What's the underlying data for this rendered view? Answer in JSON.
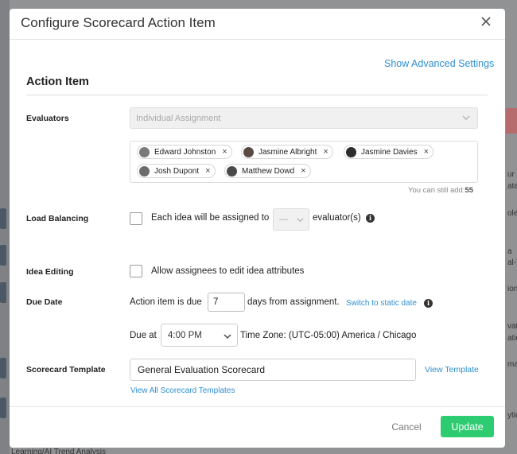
{
  "background": {
    "right_fragments": [
      "ur s",
      "ate",
      "ole",
      "a",
      "al-T",
      "ion",
      "vat",
      "atio",
      "ma",
      "ytic"
    ],
    "bottom_fragment": "Learning/AI Trend Analysis"
  },
  "modal": {
    "title": "Configure Scorecard Action Item",
    "close_icon": "close-icon",
    "advanced_link": "Show Advanced Settings",
    "section_title": "Action Item",
    "evaluators": {
      "label": "Evaluators",
      "assignment_type": "Individual Assignment",
      "chips": [
        {
          "name": "Edward Johnston",
          "avatar_color": "#7a7a7a"
        },
        {
          "name": "Jasmine Albright",
          "avatar_color": "#5a4a44"
        },
        {
          "name": "Jasmine Davies",
          "avatar_color": "#2d2d2d"
        },
        {
          "name": "Josh Dupont",
          "avatar_color": "#6b6b6b"
        },
        {
          "name": "Matthew Dowd",
          "avatar_color": "#4a4a4a"
        }
      ],
      "still_add_prefix": "You can still add:",
      "still_add_count": "55"
    },
    "load_balancing": {
      "label": "Load Balancing",
      "text_before": "Each idea will be assigned to",
      "select_value": "—",
      "text_after": "evaluator(s)"
    },
    "idea_editing": {
      "label": "Idea Editing",
      "text": "Allow assignees to edit idea attributes"
    },
    "due_date": {
      "label": "Due Date",
      "text_before": "Action item is due",
      "days": "7",
      "text_after": "days from assignment.",
      "static_link": "Switch to static date",
      "due_at_label": "Due at",
      "time": "4:00 PM",
      "timezone": "Time Zone: (UTC-05:00) America / Chicago"
    },
    "scorecard_template": {
      "label": "Scorecard Template",
      "value": "General Evaluation Scorecard",
      "view_link": "View Template",
      "view_all_link": "View All Scorecard Templates"
    },
    "footer": {
      "cancel": "Cancel",
      "update": "Update"
    },
    "colors": {
      "accent_link": "#2f8fd0",
      "update_button": "#2ecc71"
    }
  }
}
